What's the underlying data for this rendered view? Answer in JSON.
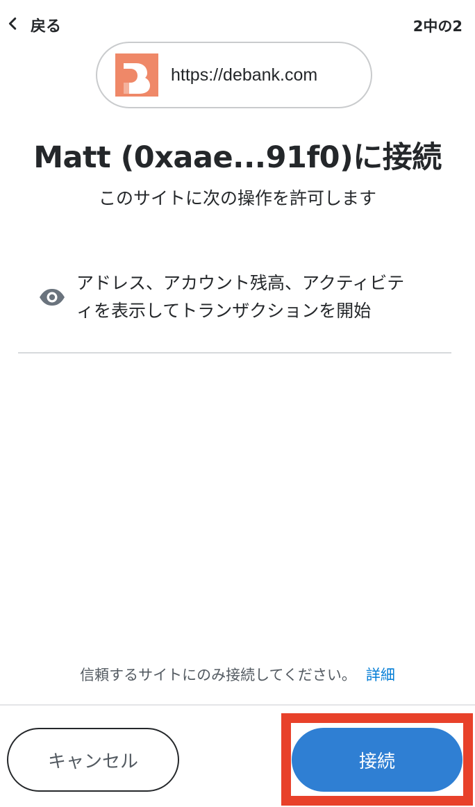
{
  "header": {
    "back_label": "戻る",
    "step": "2中の2"
  },
  "site": {
    "url": "https://debank.com",
    "logo_color": "#ef8868"
  },
  "title": "Matt (0xaae...91f0)に接続",
  "subtitle": "このサイトに次の操作を許可します",
  "permission": {
    "icon": "eye-icon",
    "text_line1": "アドレス、アカウント残高、アクティビテ",
    "text_line2": "ィを表示してトランザクションを開始"
  },
  "footer": {
    "note": "信頼するサイトにのみ接続してください。",
    "link": "詳細"
  },
  "buttons": {
    "cancel": "キャンセル",
    "connect": "接続"
  },
  "colors": {
    "primary": "#2f7fd3",
    "link": "#037dd6",
    "highlight": "#e8412a"
  }
}
